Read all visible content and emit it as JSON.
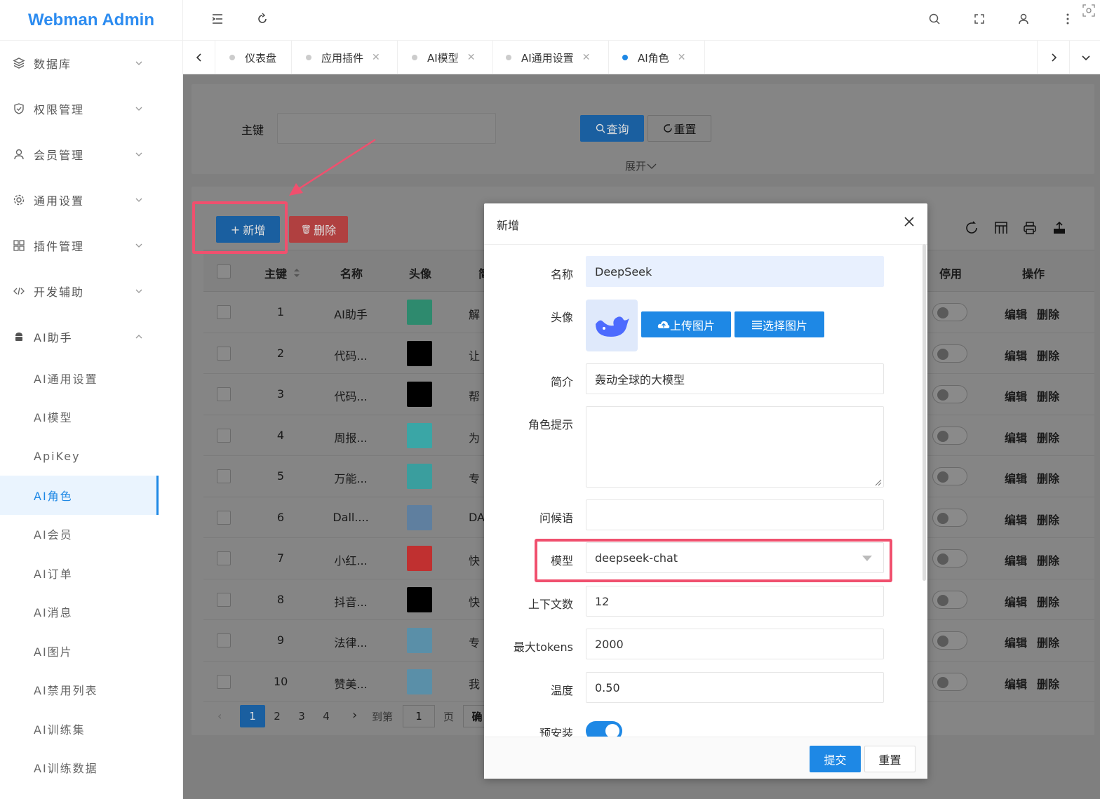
{
  "app": {
    "title": "Webman Admin"
  },
  "sidebar": {
    "menus": [
      {
        "label": "数据库",
        "icon": "database-icon"
      },
      {
        "label": "权限管理",
        "icon": "shield-icon"
      },
      {
        "label": "会员管理",
        "icon": "user-icon"
      },
      {
        "label": "通用设置",
        "icon": "gear-icon"
      },
      {
        "label": "插件管理",
        "icon": "grid-icon"
      },
      {
        "label": "开发辅助",
        "icon": "code-icon"
      },
      {
        "label": "AI助手",
        "icon": "android-icon"
      }
    ],
    "sub_items": [
      "AI通用设置",
      "AI模型",
      "ApiKey",
      "AI角色",
      "AI会员",
      "AI订单",
      "AI消息",
      "AI图片",
      "AI禁用列表",
      "AI训练集",
      "AI训练数据"
    ],
    "active_sub": "AI角色"
  },
  "tabs": [
    {
      "label": "仪表盘",
      "closable": false
    },
    {
      "label": "应用插件",
      "closable": true
    },
    {
      "label": "AI模型",
      "closable": true
    },
    {
      "label": "AI通用设置",
      "closable": true
    },
    {
      "label": "AI角色",
      "closable": true,
      "active": true
    }
  ],
  "search": {
    "key_label": "主键",
    "query_label": "查询",
    "reset_label": "重置",
    "expand_label": "展开"
  },
  "toolbar": {
    "add_label": "新增",
    "delete_label": "删除"
  },
  "table": {
    "headers": {
      "id": "主键",
      "name": "名称",
      "avatar": "头像",
      "intro": "简",
      "disabled": "停用",
      "ops": "操作"
    },
    "rows": [
      {
        "id": "1",
        "name": "AI助手",
        "intro": "解",
        "avatar_color": "#2e8a6e"
      },
      {
        "id": "2",
        "name": "代码...",
        "intro": "让",
        "avatar_color": "#000000"
      },
      {
        "id": "3",
        "name": "代码...",
        "intro": "帮",
        "avatar_color": "#000000"
      },
      {
        "id": "4",
        "name": "周报...",
        "intro": "为",
        "avatar_color": "#3aa6a6"
      },
      {
        "id": "5",
        "name": "万能...",
        "intro": "专",
        "avatar_color": "#3a9e9e"
      },
      {
        "id": "6",
        "name": "Dall....",
        "intro": "DA",
        "avatar_color": "#5f7f9f"
      },
      {
        "id": "7",
        "name": "小红...",
        "intro": "快",
        "avatar_color": "#c03030"
      },
      {
        "id": "8",
        "name": "抖音...",
        "intro": "快",
        "avatar_color": "#000000"
      },
      {
        "id": "9",
        "name": "法律...",
        "intro": "专",
        "avatar_color": "#5a8fa8"
      },
      {
        "id": "10",
        "name": "赞美...",
        "intro": "我",
        "avatar_color": "#5a8fa8"
      }
    ],
    "edit_label": "编辑",
    "delete_label": "删除"
  },
  "pagination": {
    "pages": [
      "1",
      "2",
      "3",
      "4"
    ],
    "current": "1",
    "goto_label": "到第",
    "goto_value": "1",
    "page_unit": "页",
    "confirm_label": "确"
  },
  "modal": {
    "title": "新增",
    "fields": {
      "name_label": "名称",
      "name_value": "DeepSeek",
      "avatar_label": "头像",
      "upload_label": "上传图片",
      "choose_label": "选择图片",
      "intro_label": "简介",
      "intro_value": "轰动全球的大模型",
      "prompt_label": "角色提示",
      "prompt_value": "",
      "greeting_label": "问候语",
      "greeting_value": "",
      "model_label": "模型",
      "model_value": "deepseek-chat",
      "context_label": "上下文数",
      "context_value": "12",
      "tokens_label": "最大tokens",
      "tokens_value": "2000",
      "temp_label": "温度",
      "temp_value": "0.50",
      "preinstall_label": "预安装"
    },
    "submit_label": "提交",
    "reset_label": "重置"
  },
  "colors": {
    "primary": "#1e88e5",
    "danger": "#e05050",
    "highlight": "#f0506e",
    "toggle_on": "#1e88e5"
  }
}
